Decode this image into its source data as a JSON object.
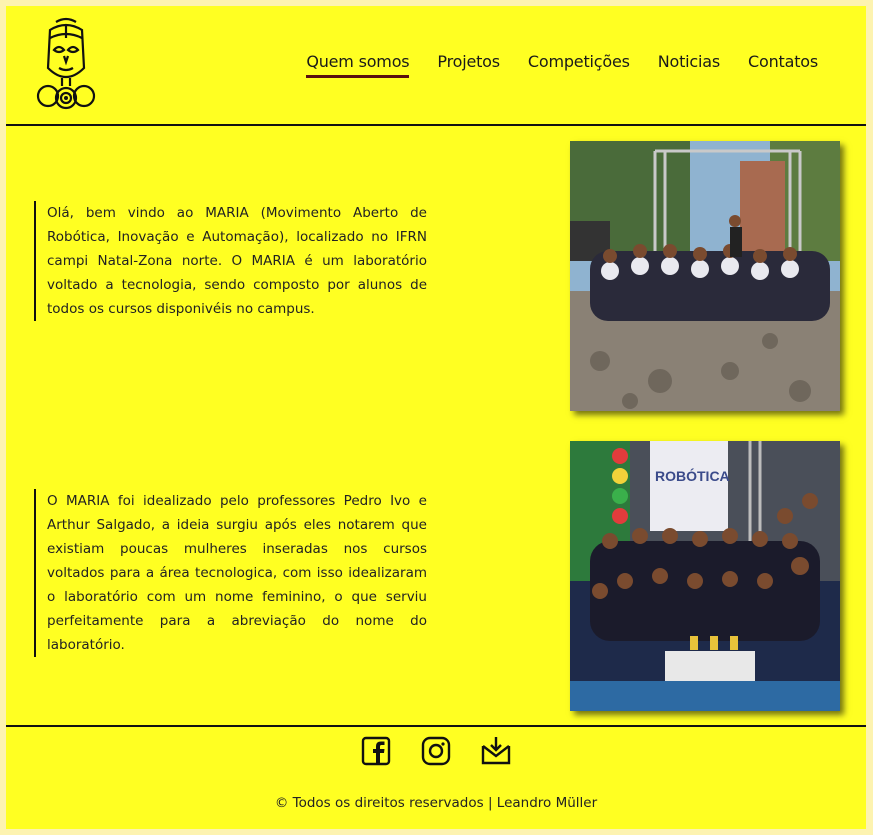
{
  "header": {
    "logo_icon": "mask-logo-icon",
    "nav": [
      {
        "label": "Quem somos",
        "active": true
      },
      {
        "label": "Projetos",
        "active": false
      },
      {
        "label": "Competições",
        "active": false
      },
      {
        "label": "Noticias",
        "active": false
      },
      {
        "label": "Contatos",
        "active": false
      }
    ]
  },
  "sections": [
    {
      "text": "Olá, bem vindo ao MARIA (Movimento Aberto de Robótica, Inovação e Automação), localizado no IFRN campi Natal-Zona norte. O MARIA é um laboratório voltado a tecnologia, sendo composto por alunos de todos os cursos disponivéis no campus.",
      "photo_icon": "group-photo-outdoor"
    },
    {
      "text": "O MARIA foi idealizado pelo professores Pedro Ivo e Arthur Salgado, a ideia surgiu após eles notarem que existiam poucas mulheres inseradas nos cursos voltados para a área tecnologica, com isso idealizaram o laboratório com um nome feminino, o que serviu perfeitamente para a abreviação do nome do laboratório.",
      "photo_icon": "group-photo-robotics-event",
      "banner": "ROBÓTICA"
    }
  ],
  "footer": {
    "icons": [
      "facebook-icon",
      "instagram-icon",
      "mail-icon"
    ],
    "copyright": "© Todos os direitos reservados | Leandro Müller"
  },
  "colors": {
    "background": "#ffff22",
    "accent": "#5a0f0f",
    "outer": "#fdf3b0"
  }
}
